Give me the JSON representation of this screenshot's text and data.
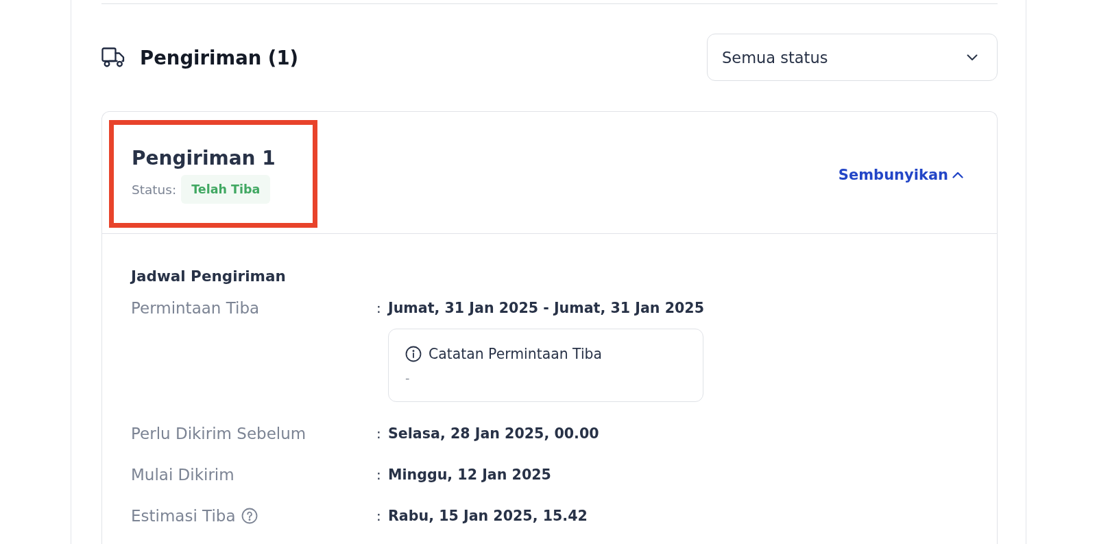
{
  "section": {
    "title": "Pengiriman (1)",
    "filter": {
      "value": "Semua status"
    }
  },
  "shipments": [
    {
      "title": "Pengiriman 1",
      "highlighted": true,
      "status_label": "Status:",
      "status": {
        "text": "Telah Tiba",
        "color": "#41a862"
      },
      "toggle": {
        "label": "Sembunyikan",
        "expanded": true
      },
      "schedule": {
        "heading": "Jadwal Pengiriman",
        "rows": [
          {
            "label": "Permintaan Tiba",
            "help": false,
            "colon": ":",
            "value": "Jumat, 31 Jan 2025 - Jumat, 31 Jan 2025",
            "note": {
              "title": "Catatan Permintaan Tiba",
              "text": "-"
            }
          },
          {
            "label": "Perlu Dikirim Sebelum",
            "help": false,
            "colon": ":",
            "value": "Selasa, 28 Jan 2025, 00.00"
          },
          {
            "label": "Mulai Dikirim",
            "help": false,
            "colon": ":",
            "value": "Minggu, 12 Jan 2025"
          },
          {
            "label": "Estimasi Tiba",
            "help": true,
            "colon": ":",
            "value": "Rabu, 15 Jan 2025, 15.42"
          }
        ]
      }
    }
  ]
}
